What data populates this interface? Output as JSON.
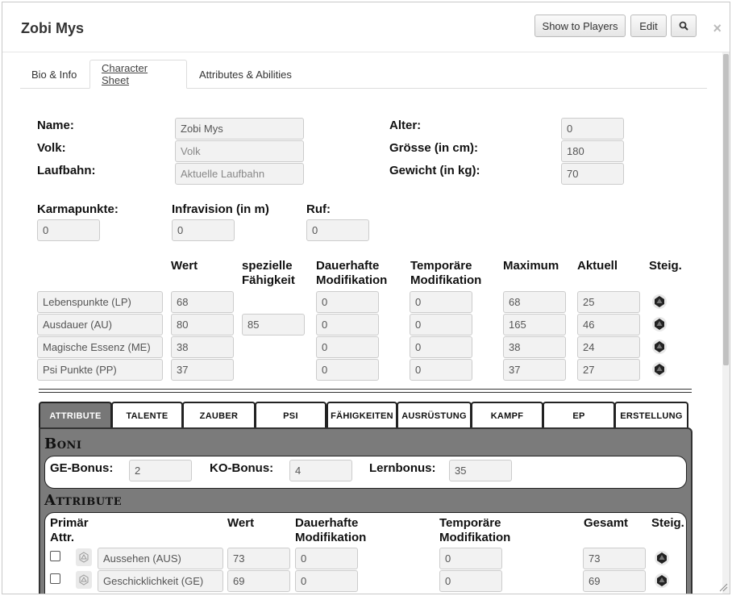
{
  "window": {
    "title": "Zobi Mys",
    "buttons": {
      "show_to_players": "Show to Players",
      "edit": "Edit"
    },
    "close": "×"
  },
  "tabs": [
    "Bio & Info",
    "Character Sheet",
    "Attributes & Abilities"
  ],
  "active_tab": "Character Sheet",
  "general": {
    "name_label": "Name:",
    "name_value": "Zobi Mys",
    "volk_label": "Volk:",
    "volk_placeholder": "Volk",
    "laufbahn_label": "Laufbahn:",
    "laufbahn_placeholder": "Aktuelle Laufbahn",
    "alter_label": "Alter:",
    "alter_value": "0",
    "groesse_label": "Grösse (in cm):",
    "groesse_value": "180",
    "gewicht_label": "Gewicht (in kg):",
    "gewicht_value": "70"
  },
  "extra": {
    "karma_label": "Karmapunkte:",
    "karma_value": "0",
    "infravision_label": "Infravision (in m)",
    "infravision_value": "0",
    "ruf_label": "Ruf:",
    "ruf_value": "0"
  },
  "pools": {
    "headers": {
      "wert": "Wert",
      "spezielle": [
        "spezielle",
        "Fähigkeit"
      ],
      "dauerhafte": [
        "Dauerhafte",
        "Modifikation"
      ],
      "temporaere": [
        "Temporäre",
        "Modifikation"
      ],
      "maximum": "Maximum",
      "aktuell": "Aktuell",
      "steig": "Steig."
    },
    "rows": [
      {
        "name": "Lebenspunkte (LP)",
        "wert": "68",
        "spezielle": "",
        "dauerhafte": "0",
        "temporaere": "0",
        "maximum": "68",
        "aktuell": "25"
      },
      {
        "name": "Ausdauer (AU)",
        "wert": "80",
        "spezielle": "85",
        "dauerhafte": "0",
        "temporaere": "0",
        "maximum": "165",
        "aktuell": "46"
      },
      {
        "name": "Magische Essenz (ME)",
        "wert": "38",
        "spezielle": "",
        "dauerhafte": "0",
        "temporaere": "0",
        "maximum": "38",
        "aktuell": "24"
      },
      {
        "name": "Psi Punkte (PP)",
        "wert": "37",
        "spezielle": "",
        "dauerhafte": "0",
        "temporaere": "0",
        "maximum": "37",
        "aktuell": "27"
      }
    ]
  },
  "subtabs": [
    "ATTRIBUTE",
    "TALENTE",
    "ZAUBER",
    "PSI",
    "FÄHIGKEITEN",
    "AUSRÜSTUNG",
    "KAMPF",
    "EP",
    "ERSTELLUNG"
  ],
  "active_subtab": "ATTRIBUTE",
  "boni": {
    "title": "Boni",
    "ge_label": "GE-Bonus:",
    "ge_value": "2",
    "ko_label": "KO-Bonus:",
    "ko_value": "4",
    "lern_label": "Lernbonus:",
    "lern_value": "35"
  },
  "attribute": {
    "title": "Attribute",
    "headers": {
      "primaer": [
        "Primär",
        "Attr."
      ],
      "wert": "Wert",
      "dauerhafte": [
        "Dauerhafte",
        "Modifikation"
      ],
      "temporaere": [
        "Temporäre",
        "Modifikation"
      ],
      "gesamt": "Gesamt",
      "steig": "Steig."
    },
    "rows": [
      {
        "name": "Aussehen (AUS)",
        "wert": "73",
        "dauerhafte": "0",
        "temporaere": "0",
        "gesamt": "73"
      },
      {
        "name": "Geschicklichkeit (GE)",
        "wert": "69",
        "dauerhafte": "0",
        "temporaere": "0",
        "gesamt": "69"
      }
    ]
  },
  "colors": {
    "panel": "#7b7b7b",
    "input_bg": "#f2f2f2",
    "active_subtab": "#777777"
  }
}
